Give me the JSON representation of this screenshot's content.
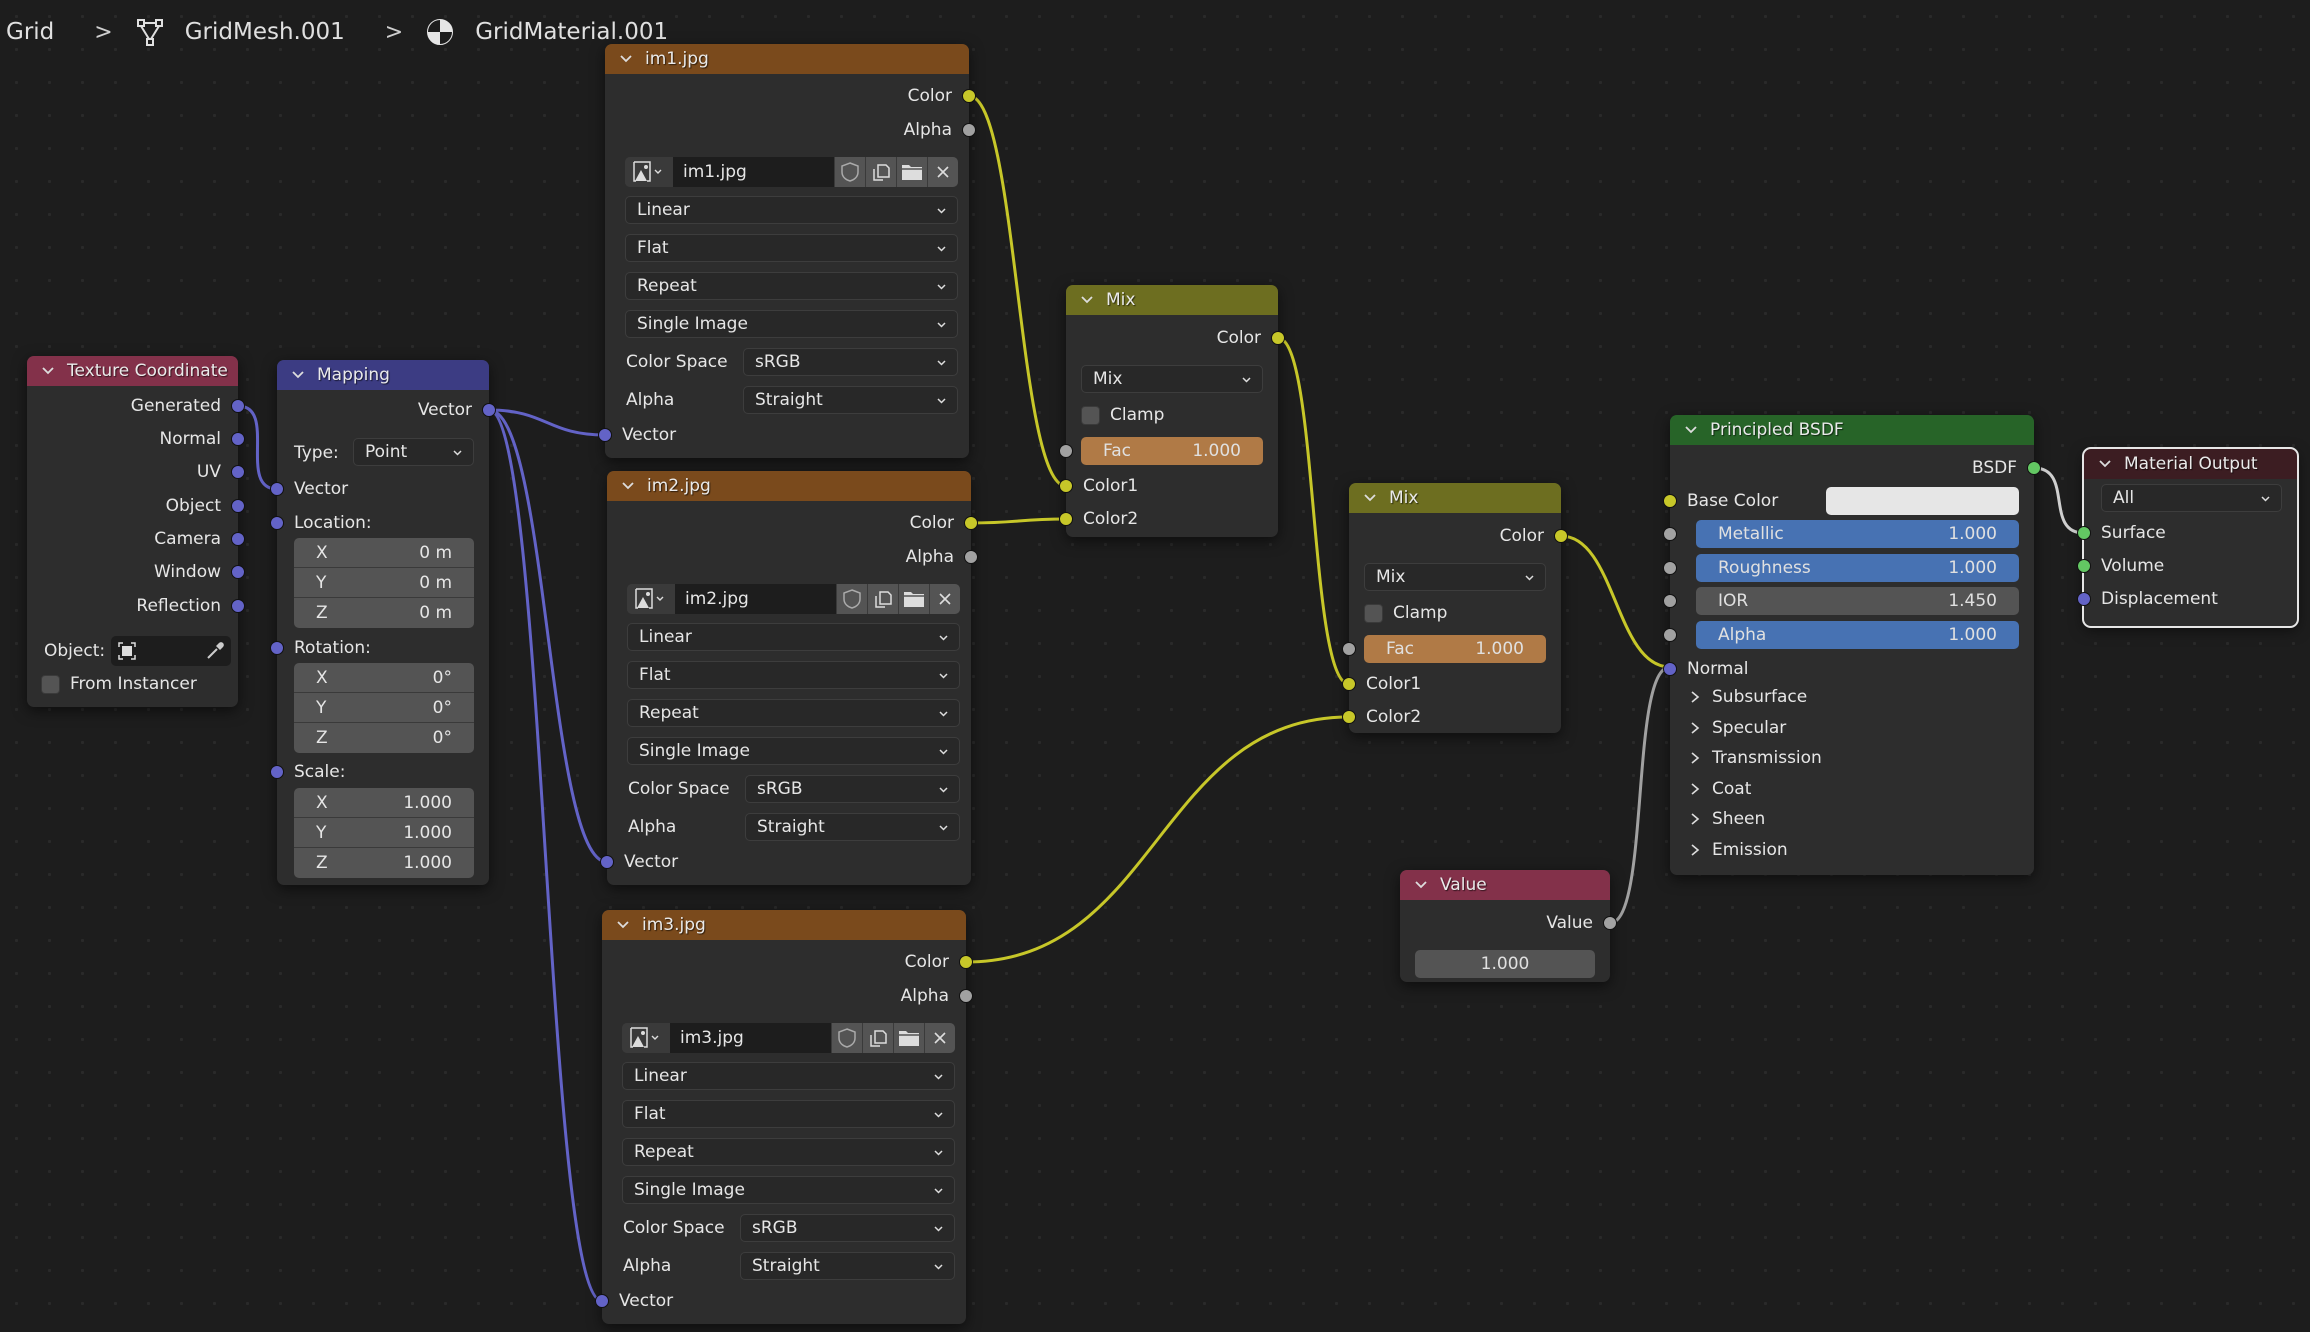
{
  "breadcrumb": {
    "items": [
      {
        "label": "Grid",
        "icon": null
      },
      {
        "label": "GridMesh.001",
        "icon": "mesh-data-icon"
      },
      {
        "label": "GridMaterial.001",
        "icon": "material-icon"
      }
    ]
  },
  "colors": {
    "background": "#1d1d1d",
    "socket_vector": "#6363c7",
    "socket_color": "#c7c729",
    "socket_float": "#a1a1a1",
    "socket_shader": "#63c763",
    "header_texture_coordinate": "#83314a",
    "header_vector": "#3c3c83",
    "header_image": "#7a4a1c",
    "header_mix": "#6d6e20",
    "header_shader": "#276428",
    "header_output": "#3c1d22",
    "fac_slider": "#b07a46",
    "blue_slider": "#4772b3"
  },
  "nodes": {
    "texcoord": {
      "title": "Texture Coordinate",
      "outputs": [
        "Generated",
        "Normal",
        "UV",
        "Object",
        "Camera",
        "Window",
        "Reflection"
      ],
      "object_label": "Object:",
      "from_instancer_label": "From Instancer",
      "from_instancer_checked": false
    },
    "mapping": {
      "title": "Mapping",
      "output": "Vector",
      "type_label": "Type:",
      "type_value": "Point",
      "vector_input": "Vector",
      "location_label": "Location:",
      "location": [
        {
          "axis": "X",
          "value": "0 m"
        },
        {
          "axis": "Y",
          "value": "0 m"
        },
        {
          "axis": "Z",
          "value": "0 m"
        }
      ],
      "rotation_label": "Rotation:",
      "rotation": [
        {
          "axis": "X",
          "value": "0°"
        },
        {
          "axis": "Y",
          "value": "0°"
        },
        {
          "axis": "Z",
          "value": "0°"
        }
      ],
      "scale_label": "Scale:",
      "scale": [
        {
          "axis": "X",
          "value": "1.000"
        },
        {
          "axis": "Y",
          "value": "1.000"
        },
        {
          "axis": "Z",
          "value": "1.000"
        }
      ]
    },
    "images": [
      {
        "title": "im1.jpg",
        "image_name": "im1.jpg",
        "out_color": "Color",
        "out_alpha": "Alpha",
        "interpolation": "Linear",
        "projection": "Flat",
        "extension": "Repeat",
        "source": "Single Image",
        "color_space_label": "Color Space",
        "color_space": "sRGB",
        "alpha_label": "Alpha",
        "alpha_mode": "Straight",
        "in_vector": "Vector"
      },
      {
        "title": "im2.jpg",
        "image_name": "im2.jpg",
        "out_color": "Color",
        "out_alpha": "Alpha",
        "interpolation": "Linear",
        "projection": "Flat",
        "extension": "Repeat",
        "source": "Single Image",
        "color_space_label": "Color Space",
        "color_space": "sRGB",
        "alpha_label": "Alpha",
        "alpha_mode": "Straight",
        "in_vector": "Vector"
      },
      {
        "title": "im3.jpg",
        "image_name": "im3.jpg",
        "out_color": "Color",
        "out_alpha": "Alpha",
        "interpolation": "Linear",
        "projection": "Flat",
        "extension": "Repeat",
        "source": "Single Image",
        "color_space_label": "Color Space",
        "color_space": "sRGB",
        "alpha_label": "Alpha",
        "alpha_mode": "Straight",
        "in_vector": "Vector"
      }
    ],
    "mix": [
      {
        "title": "Mix",
        "output": "Color",
        "blend_mode": "Mix",
        "clamp_label": "Clamp",
        "clamp": false,
        "fac_label": "Fac",
        "fac_value": "1.000",
        "in1": "Color1",
        "in2": "Color2"
      },
      {
        "title": "Mix",
        "output": "Color",
        "blend_mode": "Mix",
        "clamp_label": "Clamp",
        "clamp": false,
        "fac_label": "Fac",
        "fac_value": "1.000",
        "in1": "Color1",
        "in2": "Color2"
      }
    ],
    "bsdf": {
      "title": "Principled BSDF",
      "output": "BSDF",
      "base_color_label": "Base Color",
      "base_color": "#e6e6e6",
      "metallic_label": "Metallic",
      "metallic": "1.000",
      "roughness_label": "Roughness",
      "roughness": "1.000",
      "ior_label": "IOR",
      "ior": "1.450",
      "alpha_label": "Alpha",
      "alpha": "1.000",
      "normal_label": "Normal",
      "panels": [
        "Subsurface",
        "Specular",
        "Transmission",
        "Coat",
        "Sheen",
        "Emission"
      ]
    },
    "output": {
      "title": "Material Output",
      "target": "All",
      "inputs": [
        "Surface",
        "Volume",
        "Displacement"
      ]
    },
    "value": {
      "title": "Value",
      "output": "Value",
      "value": "1.000"
    }
  },
  "links": [
    {
      "from": "texcoord.Generated",
      "to": "mapping.Vector",
      "type": "vector"
    },
    {
      "from": "mapping.Vector",
      "to": "im1.Vector",
      "type": "vector"
    },
    {
      "from": "mapping.Vector",
      "to": "im2.Vector",
      "type": "vector"
    },
    {
      "from": "mapping.Vector",
      "to": "im3.Vector",
      "type": "vector"
    },
    {
      "from": "im1.Color",
      "to": "mix1.Color1",
      "type": "color"
    },
    {
      "from": "im2.Color",
      "to": "mix1.Color2",
      "type": "color"
    },
    {
      "from": "mix1.Color",
      "to": "mix2.Color1",
      "type": "color"
    },
    {
      "from": "im3.Color",
      "to": "mix2.Color2",
      "type": "color"
    },
    {
      "from": "mix2.Color",
      "to": "bsdf.Emission",
      "type": "color"
    },
    {
      "from": "value.Value",
      "to": "bsdf.Emission",
      "type": "float"
    },
    {
      "from": "bsdf.BSDF",
      "to": "output.Surface",
      "type": "shader"
    }
  ]
}
